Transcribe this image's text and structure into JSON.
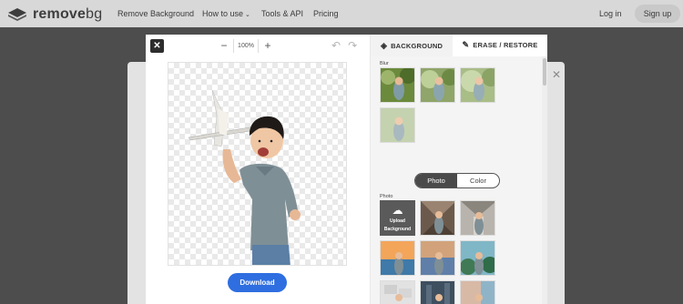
{
  "topnav": {
    "logo_text_1": "remove",
    "logo_text_2": "bg",
    "links": [
      "Remove Background",
      "How to use",
      "Tools & API",
      "Pricing"
    ],
    "login": "Log in",
    "signup": "Sign up"
  },
  "modal": {
    "close_label": "✕",
    "zoom_minus": "−",
    "zoom_value": "100%",
    "zoom_plus": "+",
    "download_label": "Download"
  },
  "panel": {
    "tab_background": "BACKGROUND",
    "tab_erase": "ERASE / RESTORE",
    "blur_label": "Blur",
    "toggle_photo": "Photo",
    "toggle_color": "Color",
    "photo_label": "Photo",
    "upload_label_1": "Upload",
    "upload_label_2": "Background"
  },
  "colors": {
    "accent": "#2f6ee0",
    "toggle_active": "#4a4a4a"
  }
}
